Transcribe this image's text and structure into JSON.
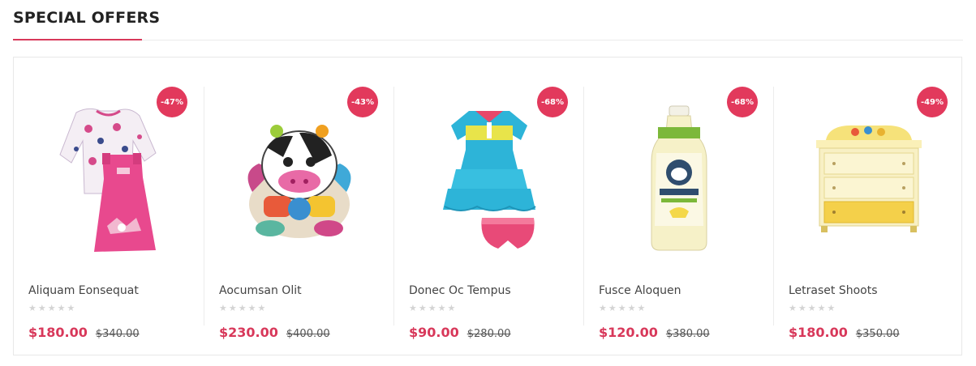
{
  "section": {
    "title": "SPECIAL OFFERS"
  },
  "colors": {
    "accent": "#d8385a",
    "badge": "#e2395c",
    "star_empty": "#d4d4d4"
  },
  "products": [
    {
      "name": "Aliquam Eonsequat",
      "discount": "-47%",
      "price": "$180.00",
      "old_price": "$340.00",
      "rating": 0,
      "image": "baby-girl-outfit"
    },
    {
      "name": "Aocumsan Olit",
      "discount": "-43%",
      "price": "$230.00",
      "old_price": "$400.00",
      "rating": 0,
      "image": "cow-plush-toy"
    },
    {
      "name": "Donec Oc Tempus",
      "discount": "-68%",
      "price": "$90.00",
      "old_price": "$280.00",
      "rating": 0,
      "image": "ruffle-dress-set"
    },
    {
      "name": "Fusce Aloquen",
      "discount": "-68%",
      "price": "$120.00",
      "old_price": "$380.00",
      "rating": 0,
      "image": "organic-bananamilk-bottle"
    },
    {
      "name": "Letraset Shoots",
      "discount": "-49%",
      "price": "$180.00",
      "old_price": "$350.00",
      "rating": 0,
      "image": "yellow-kids-dresser"
    }
  ]
}
